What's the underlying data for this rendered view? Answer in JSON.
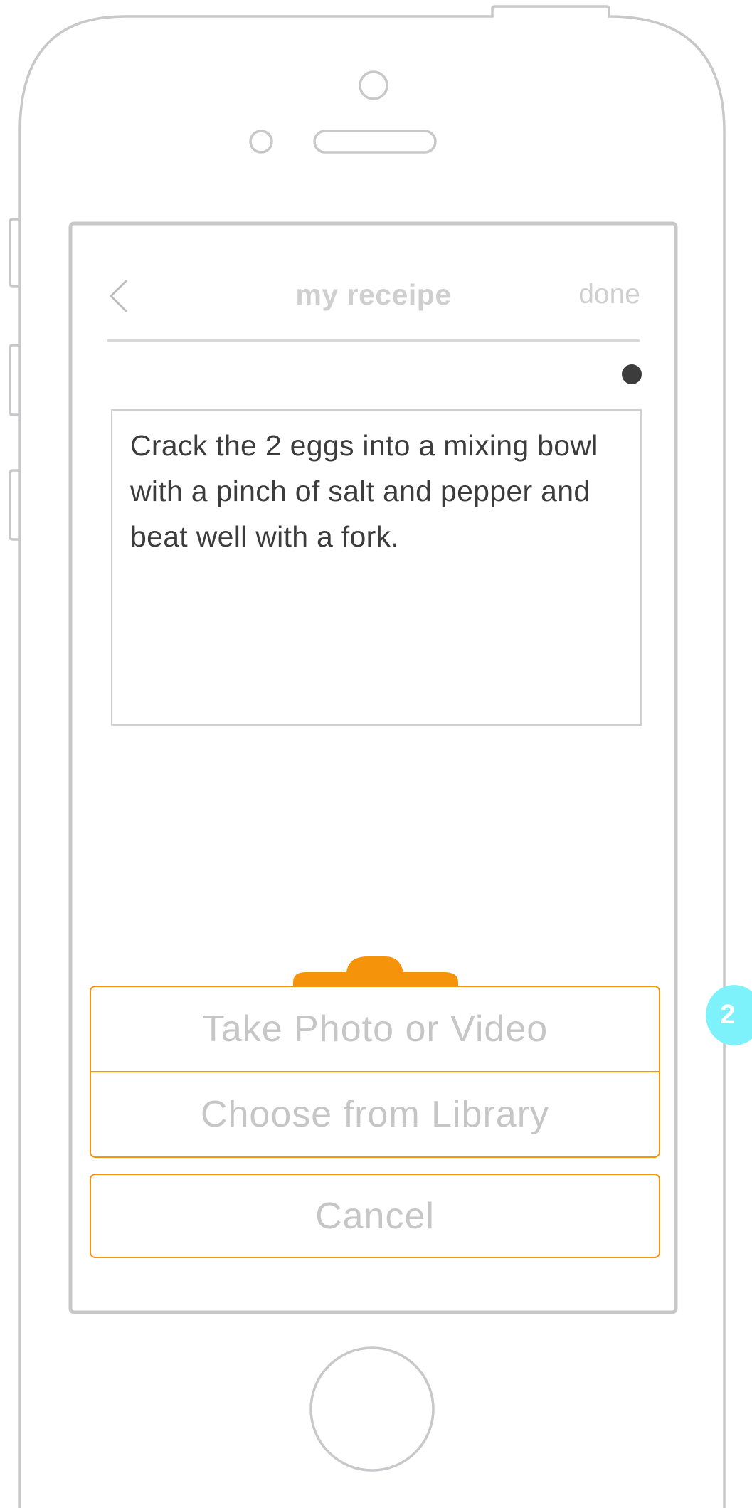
{
  "nav": {
    "title": "my receipe",
    "done_label": "done",
    "back_icon": "chevron-left-icon"
  },
  "step": {
    "text": "Crack the 2 eggs into a mixing bowl with a pinch of salt and pepper and beat well with a fork."
  },
  "action_sheet": {
    "take_photo_label": "Take Photo or Video",
    "choose_library_label": "Choose from Library",
    "cancel_label": "Cancel"
  },
  "annotation": {
    "badge_label": "2"
  },
  "colors": {
    "accent": "#f5930b",
    "frame": "#c8c8cb",
    "text_dark": "#3c3c3c",
    "text_muted": "#c6c6c6",
    "badge": "#7ef2fb"
  }
}
